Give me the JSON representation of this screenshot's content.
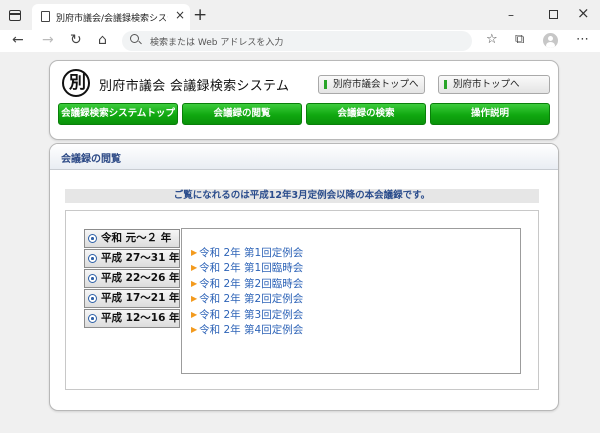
{
  "browser": {
    "tab_title": "別府市議会/会議録検索システム",
    "tab_close": "×",
    "new_tab": "+",
    "address_placeholder": "検索または Web アドレスを入力",
    "back": "←",
    "forward": "→",
    "reload": "↻",
    "home": "⌂",
    "window_min": "–",
    "window_close": "×"
  },
  "header": {
    "logo_text": "別",
    "site_title": "別府市議会 会議録検索システム",
    "top_links": [
      "別府市議会トップへ",
      "別府市トップへ"
    ],
    "nav_buttons": [
      "会議録検索システムトップ",
      "会議録の閲覧",
      "会議録の検索",
      "操作説明"
    ]
  },
  "main": {
    "title": "会議録の閲覧",
    "notice": "ご覧になれるのは平成12年3月定例会以降の本会議録です。",
    "eras": [
      "令和 元～２ 年",
      "平成 27～31 年",
      "平成 22～26 年",
      "平成 17～21 年",
      "平成 12～16 年"
    ],
    "sessions": [
      "令和 2年 第1回定例会",
      "令和 2年 第1回臨時会",
      "令和 2年 第2回臨時会",
      "令和 2年 第2回定例会",
      "令和 2年 第3回定例会",
      "令和 2年 第4回定例会"
    ]
  },
  "icons": {
    "session_marker": "▶",
    "accent_green": "#10a810",
    "link_blue": "#2d63b7",
    "title_blue": "#2d4a86",
    "marker_orange": "#f39a1d"
  }
}
